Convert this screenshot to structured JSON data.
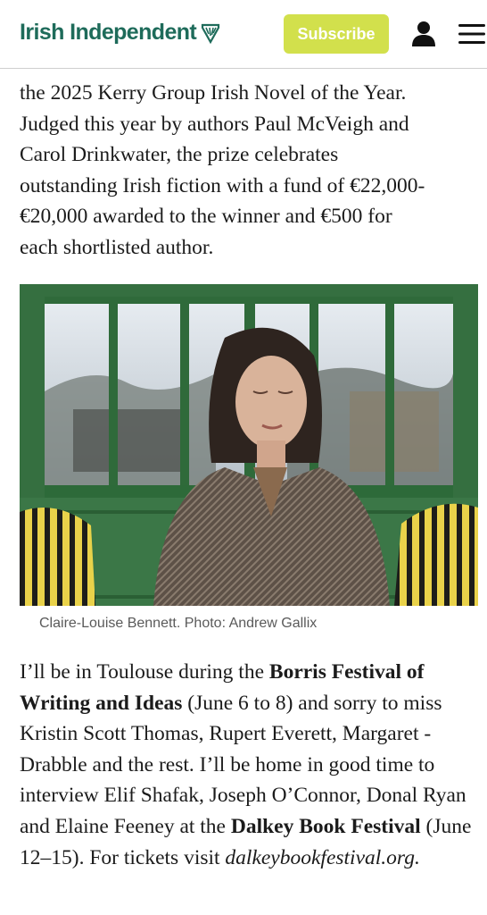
{
  "header": {
    "brand": "Irish Independent",
    "subscribe_label": "Subscribe",
    "brand_color": "#1e6b5a",
    "subscribe_color": "#d2e04c"
  },
  "article": {
    "para1": {
      "line1": "the 2025 Kerry Group Irish Novel of the Year.",
      "line2": "Judged this year by authors Paul McVeigh and",
      "line3": "Carol Drinkwater, the prize celebrates",
      "line4": "outstanding Irish fiction with a fund of €22,000-",
      "line5": "€20,000 awarded to the winner and €500 for",
      "line6": "each shortlisted author."
    },
    "photo_caption": "Claire-Louise Bennett. Photo: Andrew Gallix",
    "para2": {
      "p1": "I’ll be in Toulouse during the ",
      "b1": "Borris Festival of Writing and Ideas",
      "p2": " (June 6 to 8) and sorry to miss Kristin Scott Thomas, Rupert Everett, Margaret ‑ Drabble and the rest. I’ll be home in good time to interview Elif Shafak, Joseph O’Connor, Donal Ryan and Elaine Feeney at the ",
      "b2": "Dalkey Book Festival",
      "p3": " (June 12–15). For tickets visit ",
      "link": "dalkeybookfestival.org",
      "p4": "."
    }
  }
}
